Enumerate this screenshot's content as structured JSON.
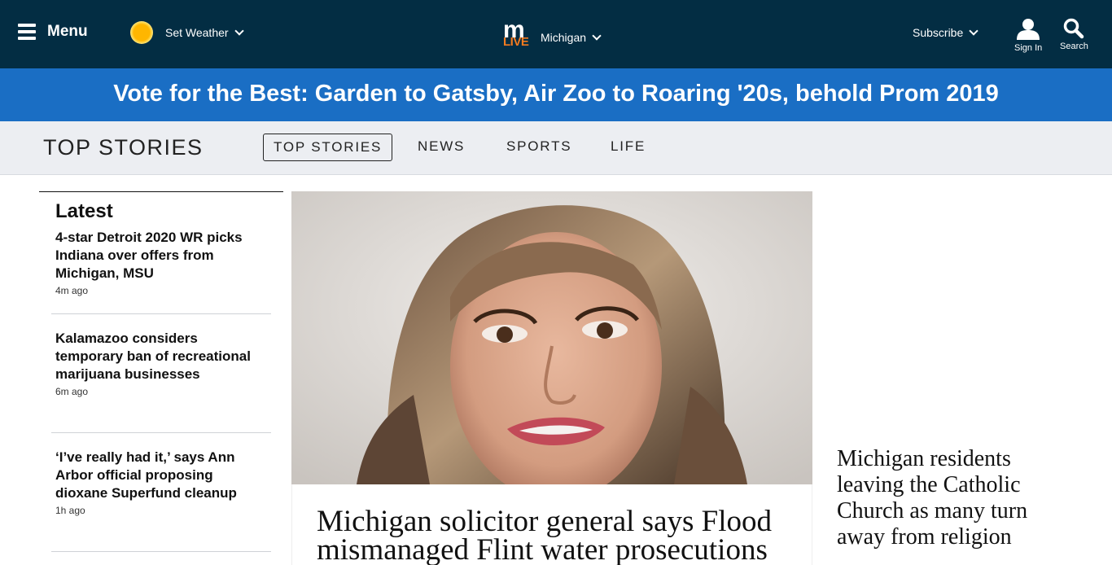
{
  "header": {
    "menu_label": "Menu",
    "weather_label": "Set Weather",
    "logo_top": "m",
    "logo_bottom": "LIVE",
    "region": "Michigan",
    "subscribe_label": "Subscribe",
    "signin_label": "Sign In",
    "search_label": "Search"
  },
  "promo": {
    "text": "Vote for the Best: Garden to Gatsby, Air Zoo to Roaring '20s, behold Prom 2019"
  },
  "section_nav": {
    "title": "TOP STORIES",
    "tabs": [
      {
        "label": "TOP STORIES",
        "active": true
      },
      {
        "label": "NEWS",
        "active": false
      },
      {
        "label": "SPORTS",
        "active": false
      },
      {
        "label": "LIFE",
        "active": false
      }
    ]
  },
  "latest": {
    "heading": "Latest",
    "items": [
      {
        "headline": "4-star Detroit 2020 WR picks Indiana over offers from Michigan, MSU",
        "time": "4m ago"
      },
      {
        "headline": "Kalamazoo considers temporary ban of recreational marijuana businesses",
        "time": "6m ago"
      },
      {
        "headline": "‘I’ve really had it,’ says Ann Arbor official proposing dioxane Superfund cleanup",
        "time": "1h ago"
      }
    ]
  },
  "lead_story": {
    "headline": "Michigan solicitor general says Flood mismanaged Flint water prosecutions"
  },
  "right_story": {
    "headline": "Michigan residents leaving the Catholic Church as many turn away from religion"
  },
  "colors": {
    "header_bg": "#032d43",
    "promo_bg": "#1a6ec4",
    "logo_accent": "#f47b20",
    "nav_bg": "#eceef2"
  }
}
